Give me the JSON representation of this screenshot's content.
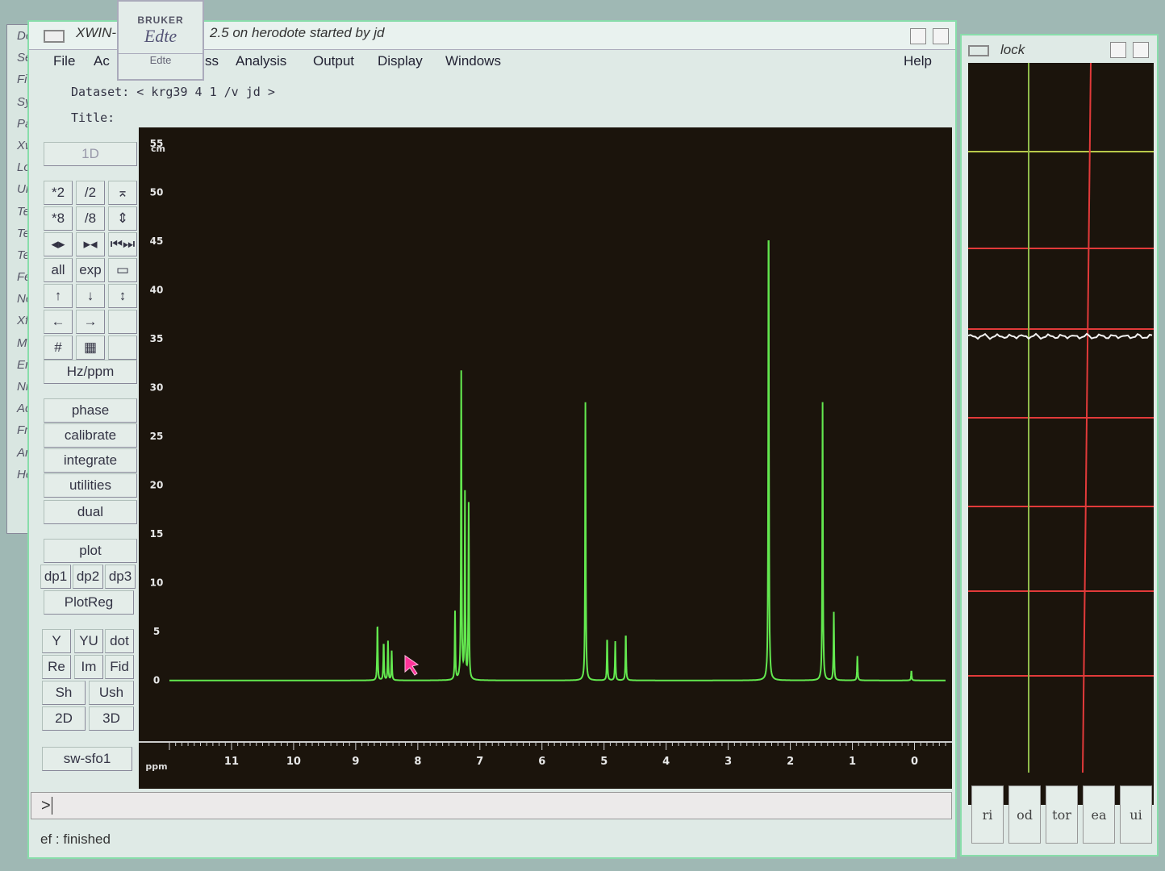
{
  "desktop_menu": [
    "De",
    "Se",
    "Fi",
    "Sy",
    "Pa",
    "Xw",
    "Lo",
    "Ur",
    "Te",
    "Te",
    "Te",
    "Fe",
    "Ne",
    "Xf",
    "Ma",
    "En",
    "Ni",
    "Ac",
    "Fr",
    "An",
    "He"
  ],
  "window": {
    "title_left": "XWIN-",
    "title_right": "2.5 on herodote started by jd",
    "menus": [
      "File",
      "Ac",
      "ss",
      "Analysis",
      "Output",
      "Display",
      "Windows",
      "Help"
    ],
    "dataset": "Dataset: < krg39 4 1 /v jd >",
    "title_label": "Title:"
  },
  "logo": {
    "brand": "BRUKER",
    "name": "Edte",
    "caption": "Edte"
  },
  "panel": {
    "mode": "1D",
    "zoom": [
      "*2",
      "/2",
      "⌅",
      "*8",
      "/8",
      "⇕",
      "◂▸",
      "▸◂",
      "⏮⏭"
    ],
    "view": [
      "all",
      "exp",
      "▭"
    ],
    "arrows": [
      "↑",
      "↓",
      "↕",
      "←",
      "→",
      ""
    ],
    "grid": [
      "#",
      "▦",
      ""
    ],
    "hzppm": "Hz/ppm",
    "actions": [
      "phase",
      "calibrate",
      "integrate",
      "utilities",
      "dual"
    ],
    "plot": "plot",
    "dp": [
      "dp1",
      "dp2",
      "dp3"
    ],
    "plotreg": "PlotReg",
    "disp1": [
      "Y",
      "YU",
      "dot"
    ],
    "disp2": [
      "Re",
      "Im",
      "Fid"
    ],
    "sh": [
      "Sh",
      "Ush"
    ],
    "dim": [
      "2D",
      "3D"
    ],
    "swsfo": "sw-sfo1"
  },
  "chart_data": {
    "type": "line",
    "xlabel": "ppm",
    "ylabel": "cm",
    "xlim": [
      12,
      -0.5
    ],
    "ylim": [
      -3,
      55
    ],
    "xticks": [
      11,
      10,
      9,
      8,
      7,
      6,
      5,
      4,
      3,
      2,
      1,
      0
    ],
    "yticks": [
      0,
      5,
      10,
      15,
      20,
      25,
      30,
      35,
      40,
      45,
      50,
      55
    ],
    "peaks": [
      {
        "ppm": 8.65,
        "height": 6
      },
      {
        "ppm": 8.55,
        "height": 4
      },
      {
        "ppm": 8.48,
        "height": 4
      },
      {
        "ppm": 8.42,
        "height": 3
      },
      {
        "ppm": 7.4,
        "height": 7
      },
      {
        "ppm": 7.3,
        "height": 31.5
      },
      {
        "ppm": 7.24,
        "height": 19
      },
      {
        "ppm": 7.18,
        "height": 18
      },
      {
        "ppm": 5.3,
        "height": 28.5
      },
      {
        "ppm": 4.95,
        "height": 4.5
      },
      {
        "ppm": 4.82,
        "height": 4
      },
      {
        "ppm": 4.65,
        "height": 5
      },
      {
        "ppm": 2.35,
        "height": 50
      },
      {
        "ppm": 1.48,
        "height": 28.5
      },
      {
        "ppm": 1.3,
        "height": 7
      },
      {
        "ppm": 0.92,
        "height": 2.5
      },
      {
        "ppm": 0.05,
        "height": 1
      }
    ]
  },
  "command": {
    "prompt": ">"
  },
  "status": "ef : finished",
  "lock": {
    "title": "lock",
    "buttons": [
      "ri",
      "od",
      "tor",
      "ea",
      "ui"
    ]
  },
  "colors": {
    "trace": "#63e84f",
    "background": "#1b140c",
    "lock_grid": "#e23a3a"
  }
}
